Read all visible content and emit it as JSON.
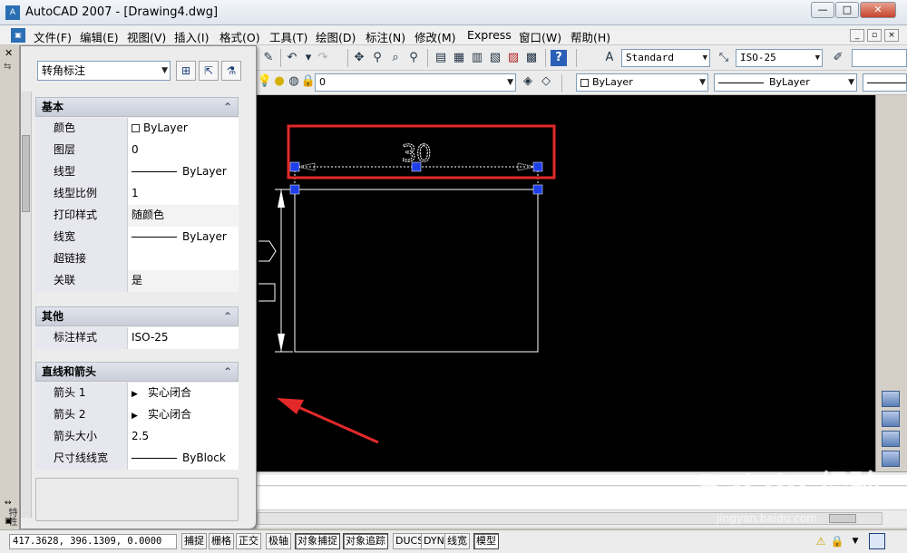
{
  "window": {
    "title": "AutoCAD 2007 - [Drawing4.dwg]",
    "app_icon_text": "A",
    "controls": [
      "—",
      "□",
      "✕"
    ]
  },
  "menu": {
    "items": [
      "文件(F)",
      "编辑(E)",
      "视图(V)",
      "插入(I)",
      "格式(O)",
      "工具(T)",
      "绘图(D)",
      "标注(N)",
      "修改(M)",
      "Express",
      "窗口(W)",
      "帮助(H)"
    ],
    "mdi_controls": [
      "_",
      "▫",
      "×"
    ]
  },
  "toolbar": {
    "text_style": "Standard",
    "dim_style": "ISO-25",
    "layer": "0",
    "color": "ByLayer",
    "linetype": "ByLayer"
  },
  "palette": {
    "object_type": "转角标注",
    "sections": [
      {
        "title": "基本",
        "rows": [
          {
            "name": "颜色",
            "value": "ByLayer",
            "kind": "color"
          },
          {
            "name": "图层",
            "value": "0",
            "kind": "text"
          },
          {
            "name": "线型",
            "value": "ByLayer",
            "kind": "line"
          },
          {
            "name": "线型比例",
            "value": "1",
            "kind": "text"
          },
          {
            "name": "打印样式",
            "value": "随颜色",
            "kind": "text"
          },
          {
            "name": "线宽",
            "value": "ByLayer",
            "kind": "line"
          },
          {
            "name": "超链接",
            "value": "",
            "kind": "text"
          },
          {
            "name": "关联",
            "value": "是",
            "kind": "text"
          }
        ]
      },
      {
        "title": "其他",
        "rows": [
          {
            "name": "标注样式",
            "value": "ISO-25",
            "kind": "text"
          }
        ]
      },
      {
        "title": "直线和箭头",
        "rows": [
          {
            "name": "箭头 1",
            "value": "实心闭合",
            "kind": "arrow"
          },
          {
            "name": "箭头 2",
            "value": "实心闭合",
            "kind": "arrow"
          },
          {
            "name": "箭头大小",
            "value": "2.5",
            "kind": "text"
          },
          {
            "name": "尺寸线线宽",
            "value": "ByBlock",
            "kind": "line"
          }
        ]
      }
    ],
    "vertical_label": "特性"
  },
  "drawing": {
    "dimension_text": "30"
  },
  "status": {
    "coords": "417.3628, 396.1309, 0.0000",
    "buttons": [
      {
        "label": "捕捉",
        "on": false
      },
      {
        "label": "栅格",
        "on": false
      },
      {
        "label": "正交",
        "on": false
      },
      {
        "label": "极轴",
        "on": false
      },
      {
        "label": "对象捕捉",
        "on": true
      },
      {
        "label": "对象追踪",
        "on": true
      },
      {
        "label": "DUCS",
        "on": false
      },
      {
        "label": "DYN",
        "on": false
      },
      {
        "label": "线宽",
        "on": false
      },
      {
        "label": "模型",
        "on": true
      }
    ]
  },
  "watermark": {
    "main": "Bai du 经验",
    "sub": "jingyan.baidu.com"
  }
}
